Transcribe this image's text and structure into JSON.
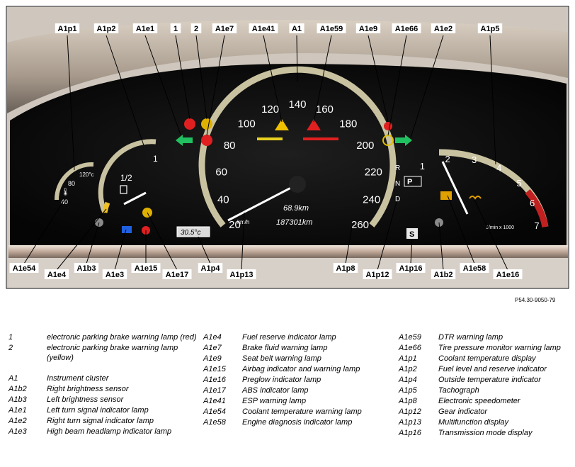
{
  "figure": {
    "callouts": {
      "A1p1": "A1p1",
      "A1p2": "A1p2",
      "A1e1": "A1e1",
      "n1": "1",
      "n2": "2",
      "A1e7": "A1e7",
      "A1e41": "A1e41",
      "A1": "A1",
      "A1e59": "A1e59",
      "A1e9": "A1e9",
      "A1e66": "A1e66",
      "A1e2": "A1e2",
      "A1p5": "A1p5",
      "A1e54": "A1e54",
      "A1e4": "A1e4",
      "A1b3": "A1b3",
      "A1e3": "A1e3",
      "A1e15": "A1e15",
      "A1e17": "A1e17",
      "A1p4": "A1p4",
      "A1p13": "A1p13",
      "A1p8": "A1p8",
      "A1p12": "A1p12",
      "A1p16": "A1p16",
      "A1b2": "A1b2",
      "A1e58": "A1e58",
      "A1e16": "A1e16"
    },
    "speedometer": {
      "ticks": [
        "20",
        "40",
        "60",
        "80",
        "100",
        "120",
        "140",
        "160",
        "180",
        "200",
        "220",
        "240",
        "260"
      ],
      "unit": "km/h",
      "trip": "68.9km",
      "odometer": "187301km"
    },
    "tachometer": {
      "ticks": [
        "1",
        "2",
        "3",
        "4",
        "5",
        "6",
        "7"
      ],
      "unit": "1/min x 1000"
    },
    "coolant": {
      "ticks": [
        "40",
        "80",
        "120°c"
      ]
    },
    "fuel": {
      "ticks": [
        "1",
        "1/2"
      ]
    },
    "outside_temp": "30.5°c",
    "gear": {
      "R": "R",
      "N": "N",
      "D": "D",
      "P": "P"
    },
    "trans_mode": "S",
    "reference": "P54.30-9050-79"
  },
  "legend": {
    "col1": [
      {
        "code": "1",
        "text": "electronic parking brake warning lamp (red)"
      },
      {
        "code": "2",
        "text": "electronic parking brake warning lamp (yellow)"
      },
      {
        "code": "A1",
        "text": "Instrument cluster"
      },
      {
        "code": "A1b2",
        "text": "Right brightness sensor"
      },
      {
        "code": "A1b3",
        "text": "Left brightness sensor"
      },
      {
        "code": "A1e1",
        "text": "Left turn signal indicator lamp"
      },
      {
        "code": "A1e2",
        "text": "Right turn signal indicator lamp"
      },
      {
        "code": "A1e3",
        "text": "High beam headlamp indicator lamp"
      }
    ],
    "col2": [
      {
        "code": "A1e4",
        "text": "Fuel reserve indicator lamp"
      },
      {
        "code": "A1e7",
        "text": "Brake fluid warning lamp"
      },
      {
        "code": "A1e9",
        "text": "Seat belt warning lamp"
      },
      {
        "code": "A1e15",
        "text": "Airbag indicator and warning lamp"
      },
      {
        "code": "A1e16",
        "text": "Preglow indicator lamp"
      },
      {
        "code": "A1e17",
        "text": "ABS indicator lamp"
      },
      {
        "code": "A1e41",
        "text": "ESP warning lamp"
      },
      {
        "code": "A1e54",
        "text": "Coolant temperature warning lamp"
      },
      {
        "code": "A1e58",
        "text": "Engine diagnosis indicator lamp"
      }
    ],
    "col3": [
      {
        "code": "A1e59",
        "text": "DTR warning lamp"
      },
      {
        "code": "A1e66",
        "text": "Tire pressure monitor warning lamp"
      },
      {
        "code": "A1p1",
        "text": "Coolant temperature display"
      },
      {
        "code": "A1p2",
        "text": "Fuel level and reserve indicator"
      },
      {
        "code": "A1p4",
        "text": "Outside temperature indicator"
      },
      {
        "code": "A1p5",
        "text": "Tachograph"
      },
      {
        "code": "A1p8",
        "text": "Electronic speedometer"
      },
      {
        "code": "A1p12",
        "text": "Gear indicator"
      },
      {
        "code": "A1p13",
        "text": "Multifunction display"
      },
      {
        "code": "A1p16",
        "text": "Transmission mode display"
      }
    ]
  }
}
